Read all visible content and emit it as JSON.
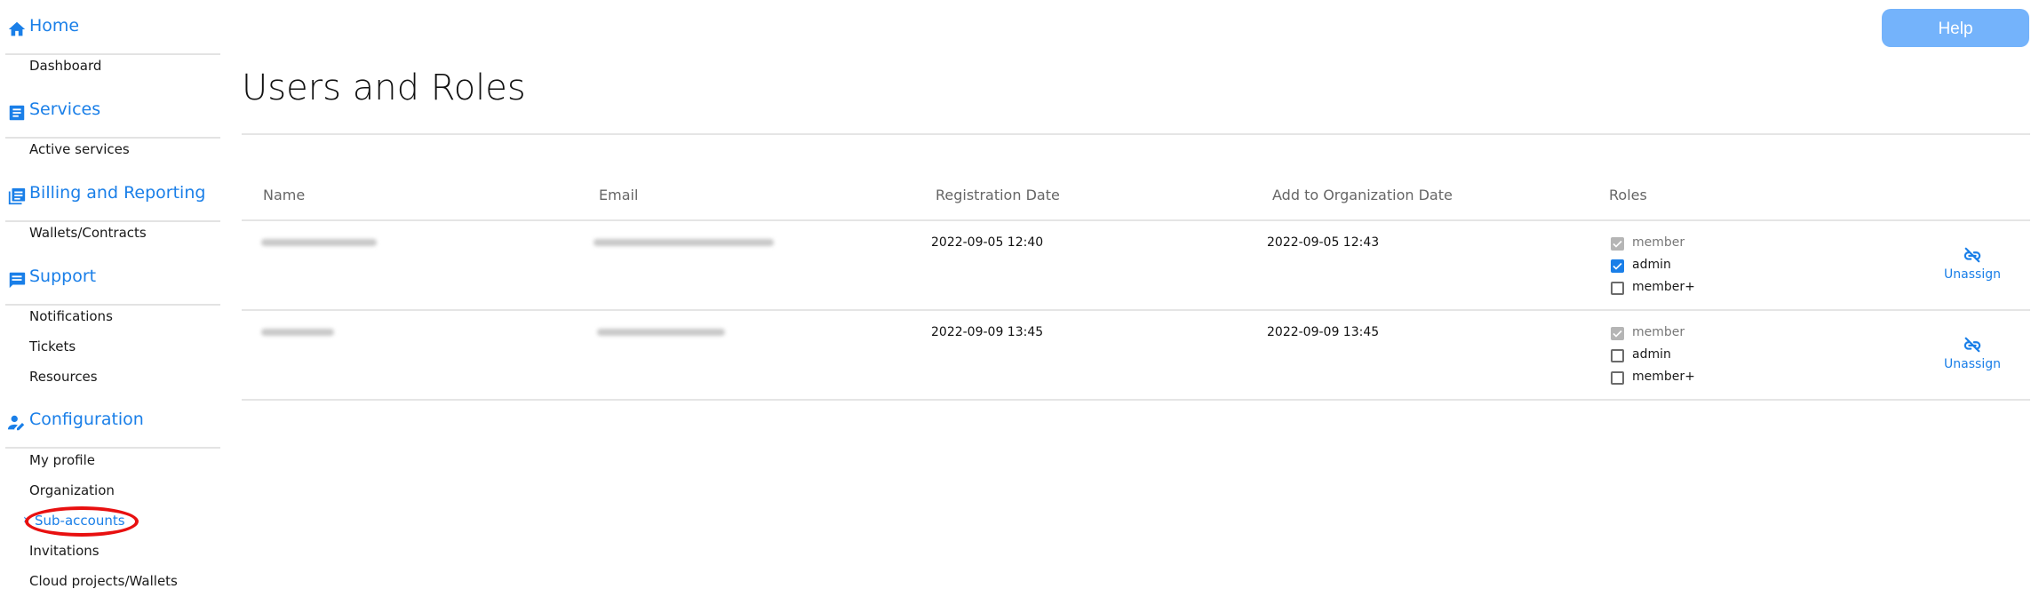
{
  "sidebar": {
    "sections": [
      {
        "label": "Home",
        "icon": "home-icon",
        "items": [
          {
            "label": "Dashboard"
          }
        ]
      },
      {
        "label": "Services",
        "icon": "document-icon",
        "items": [
          {
            "label": "Active services"
          }
        ]
      },
      {
        "label": "Billing and Reporting",
        "icon": "library-books-icon",
        "items": [
          {
            "label": "Wallets/Contracts"
          }
        ]
      },
      {
        "label": "Support",
        "icon": "chat-icon",
        "items": [
          {
            "label": "Notifications"
          },
          {
            "label": "Tickets"
          },
          {
            "label": "Resources"
          }
        ]
      },
      {
        "label": "Configuration",
        "icon": "user-edit-icon",
        "items": [
          {
            "label": "My profile"
          },
          {
            "label": "Organization"
          },
          {
            "label": "Sub-accounts",
            "active": true
          },
          {
            "label": "Invitations"
          },
          {
            "label": "Cloud projects/Wallets"
          }
        ]
      }
    ],
    "active_chevron": "›"
  },
  "header": {
    "help_label": "Help"
  },
  "page": {
    "title": "Users and Roles"
  },
  "table": {
    "columns": [
      "Name",
      "Email",
      "Registration Date",
      "Add to Organization Date",
      "Roles"
    ],
    "rows": [
      {
        "name": "[redacted]",
        "email": "[redacted]",
        "registration_date": "2022-09-05 12:40",
        "add_date": "2022-09-05 12:43",
        "roles": [
          {
            "label": "member",
            "checked": true,
            "disabled": true
          },
          {
            "label": "admin",
            "checked": true,
            "disabled": false
          },
          {
            "label": "member+",
            "checked": false,
            "disabled": false
          }
        ],
        "action": "Unassign"
      },
      {
        "name": "[redacted]",
        "email": "[redacted]",
        "registration_date": "2022-09-09 13:45",
        "add_date": "2022-09-09 13:45",
        "roles": [
          {
            "label": "member",
            "checked": true,
            "disabled": true
          },
          {
            "label": "admin",
            "checked": false,
            "disabled": false
          },
          {
            "label": "member+",
            "checked": false,
            "disabled": false
          }
        ],
        "action": "Unassign"
      }
    ]
  },
  "colors": {
    "accent": "#1a7fe8",
    "help_button": "#74b3fb",
    "annotation": "#e81010"
  }
}
